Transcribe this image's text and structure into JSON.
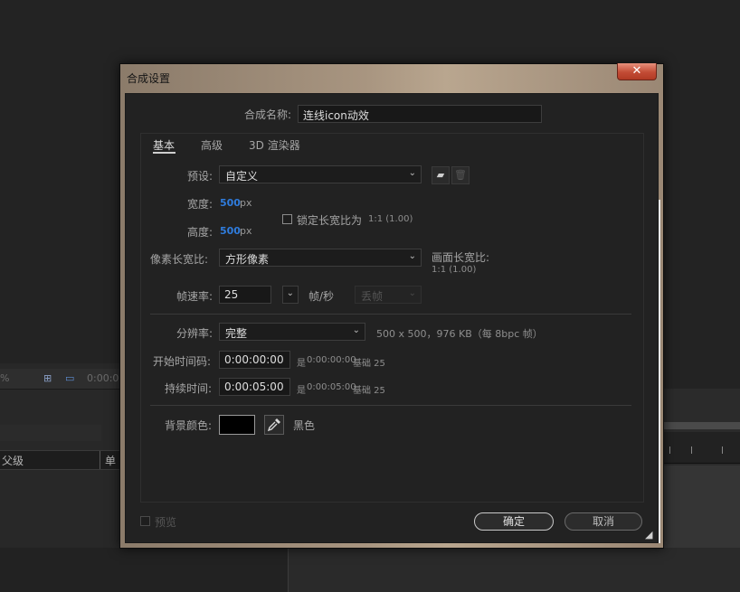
{
  "dialog": {
    "title": "合成设置",
    "close_symbol": "✕",
    "name_label": "合成名称:",
    "name_value": "连线icon动效",
    "tabs": [
      {
        "label": "基本",
        "active": true
      },
      {
        "label": "高级",
        "active": false
      },
      {
        "label": "3D 渲染器",
        "active": false
      }
    ],
    "basic": {
      "preset_label": "预设:",
      "preset_value": "自定义",
      "width_label": "宽度:",
      "width_value": "500",
      "height_label": "高度:",
      "height_value": "500",
      "unit_px": "px",
      "lock_ratio_label": "锁定长宽比为",
      "lock_ratio_value": "1:1 (1.00)",
      "pixel_aspect_label": "像素长宽比:",
      "pixel_aspect_value": "方形像素",
      "frame_aspect_label": "画面长宽比:",
      "frame_aspect_value": "1:1 (1.00)",
      "frame_rate_label": "帧速率:",
      "frame_rate_value": "25",
      "frame_rate_unit": "帧/秒",
      "frame_drop_value": "丢帧",
      "resolution_label": "分辨率:",
      "resolution_value": "完整",
      "resolution_info": "500 x 500，976 KB（每 8bpc 帧）",
      "start_tc_label": "开始时间码:",
      "start_tc_value": "0:00:00:00",
      "start_tc_info_prefix": "是",
      "start_tc_info_value": "0:00:00:00",
      "start_tc_base": "基础 25",
      "duration_label": "持续时间:",
      "duration_value": "0:00:05:00",
      "duration_info_prefix": "是",
      "duration_info_value": "0:00:05:00",
      "duration_base": "基础 25",
      "bg_color_label": "背景颜色:",
      "bg_color_name": "黑色",
      "bg_color_hex": "#000000"
    },
    "preview_label": "预览",
    "ok_label": "确定",
    "cancel_label": "取消"
  },
  "background": {
    "left_header_label": "父级",
    "left_header_label2": "单",
    "left_toolbar_zoom": "%",
    "left_toolbar_time": "0:00:0"
  },
  "colors": {
    "accent_blue": "#2f7cdd",
    "close_red": "#c34c35",
    "dialog_bg": "#222222"
  }
}
